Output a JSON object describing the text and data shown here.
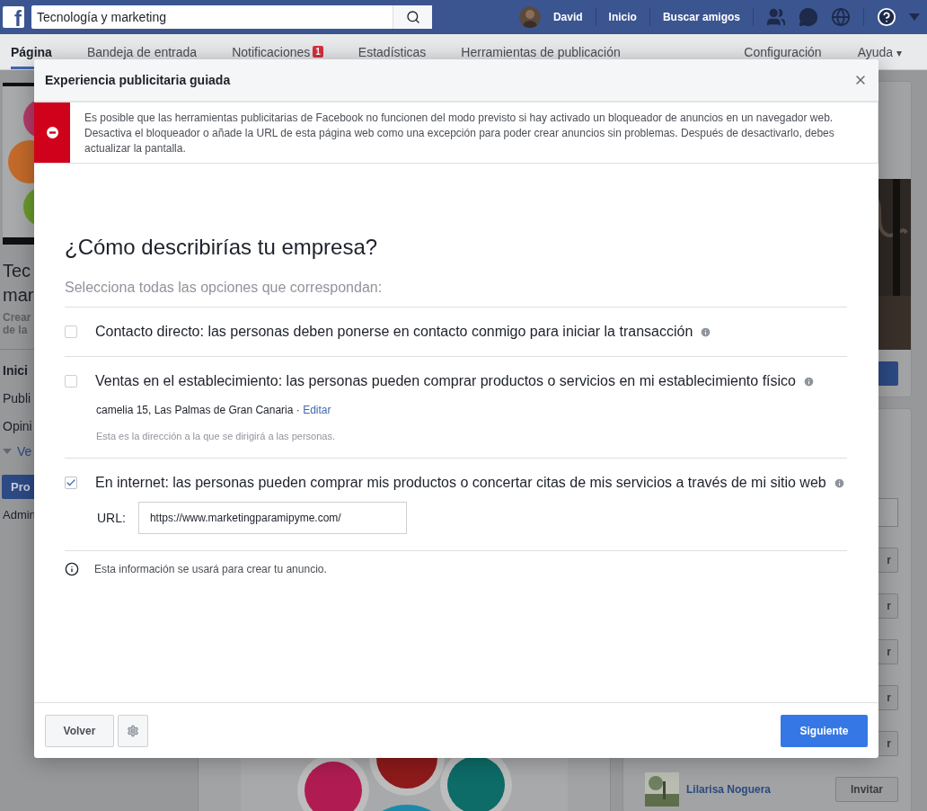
{
  "topbar": {
    "logo": "f",
    "search": {
      "value": "Tecnología y marketing"
    },
    "user": "David",
    "links": [
      "Inicio",
      "Buscar amigos"
    ]
  },
  "nav": {
    "tabs": [
      {
        "label": "Página",
        "selected": true
      },
      {
        "label": "Bandeja de entrada",
        "selected": false
      },
      {
        "label": "Notificaciones",
        "selected": false,
        "badge": "1"
      },
      {
        "label": "Estadísticas",
        "selected": false
      },
      {
        "label": "Herramientas de publicación",
        "selected": false
      }
    ],
    "right": [
      {
        "label": "Configuración"
      },
      {
        "label": "Ayuda",
        "caret": "▾"
      }
    ]
  },
  "left": {
    "title": [
      "Tec",
      "mar"
    ],
    "subtitle": [
      "Crear",
      "de la"
    ],
    "menu": [
      {
        "label": "Inici",
        "selected": true
      },
      {
        "label": "Publi",
        "selected": false
      },
      {
        "label": "Opini",
        "selected": false
      }
    ],
    "more": "Ve",
    "promote": "Pro",
    "admin": "Admin"
  },
  "right": {
    "invite_buttons": [
      "r",
      "r",
      "r",
      "r",
      "r"
    ],
    "friend": {
      "name": "Lilarisa Noguera",
      "button": "Invitar"
    }
  },
  "modal": {
    "title": "Experiencia publicitaria guiada",
    "alert": "Es posible que las herramientas publicitarias de Facebook no funcionen del modo previsto si hay activado un bloqueador de anuncios en un navegador web. Desactiva el bloqueador o añade la URL de esta página web como una excepción para poder crear anuncios sin problemas. Después de desactivarlo, debes actualizar la pantalla.",
    "heading": "¿Cómo describirías tu empresa?",
    "subheading": "Selecciona todas las opciones que correspondan:",
    "options": [
      {
        "kind": "plain",
        "label": "Contacto directo: las personas deben ponerse en contacto conmigo para iniciar la transacción",
        "checked": false
      },
      {
        "kind": "address",
        "label": "Ventas en el establecimiento: las personas pueden comprar productos o servicios en mi establecimiento físico",
        "checked": false,
        "address": "camelia 15, Las Palmas de Gran Canaria",
        "separator": "·",
        "link": "Editar",
        "note": "Esta es la dirección a la que se dirigirá a las personas."
      },
      {
        "kind": "url",
        "label": "En internet: las personas pueden comprar mis productos o concertar citas de mis servicios a través de mi sitio web",
        "checked": true,
        "field_label": "URL:",
        "value": "https://www.marketingparamipyme.com/"
      }
    ],
    "info": "Esta información se usará para crear tu anuncio.",
    "back": "Volver",
    "next": "Siguiente"
  }
}
